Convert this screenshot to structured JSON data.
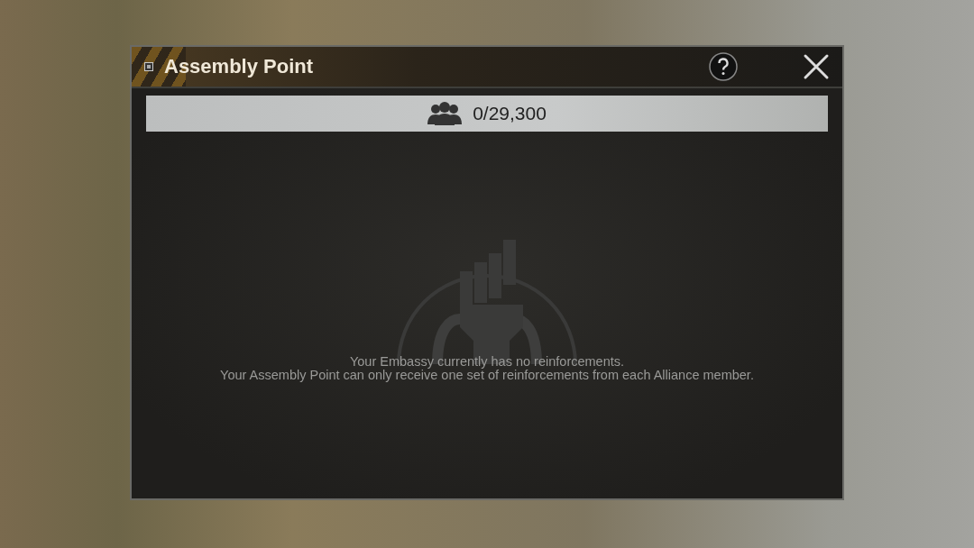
{
  "window": {
    "title": "Assembly Point"
  },
  "capacity": {
    "value": "0/29,300"
  },
  "messages": [
    "Your Embassy currently has no reinforcements.",
    "Your Assembly Point can only receive one set of reinforcements from each Alliance member."
  ]
}
